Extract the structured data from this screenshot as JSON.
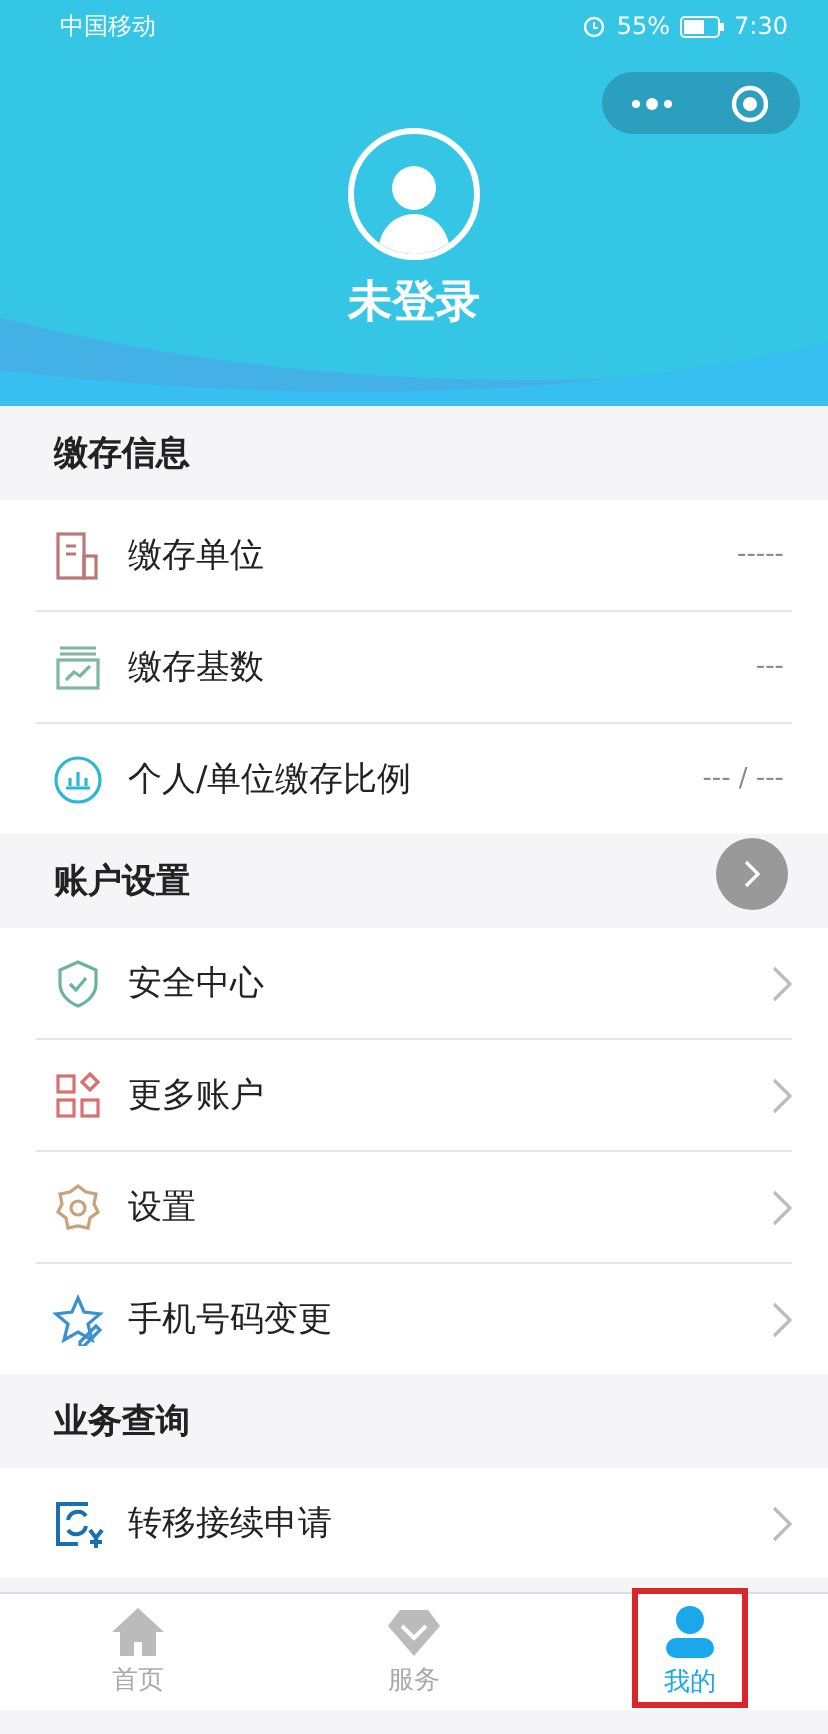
{
  "status_bar": {
    "carrier": "中国移动",
    "battery": "55%",
    "time": "7:30"
  },
  "header": {
    "user_name": "未登录"
  },
  "sections": [
    {
      "title": "缴存信息",
      "items": [
        {
          "kind": "value",
          "label": "缴存单位",
          "value": "-----"
        },
        {
          "kind": "value",
          "label": "缴存基数",
          "value": "---"
        },
        {
          "kind": "value",
          "label": "个人/单位缴存比例",
          "value": "--- / ---"
        }
      ]
    },
    {
      "title": "账户设置",
      "items": [
        {
          "kind": "link",
          "label": "安全中心"
        },
        {
          "kind": "link",
          "label": "更多账户"
        },
        {
          "kind": "link",
          "label": "设置"
        },
        {
          "kind": "link",
          "label": "手机号码变更"
        }
      ]
    },
    {
      "title": "业务查询",
      "items": [
        {
          "kind": "link",
          "label": "转移接续申请"
        }
      ]
    }
  ],
  "tabs": [
    {
      "label": "首页",
      "selected": false,
      "highlighted": false
    },
    {
      "label": "服务",
      "selected": false,
      "highlighted": false
    },
    {
      "label": "我的",
      "selected": true,
      "highlighted": true
    }
  ]
}
